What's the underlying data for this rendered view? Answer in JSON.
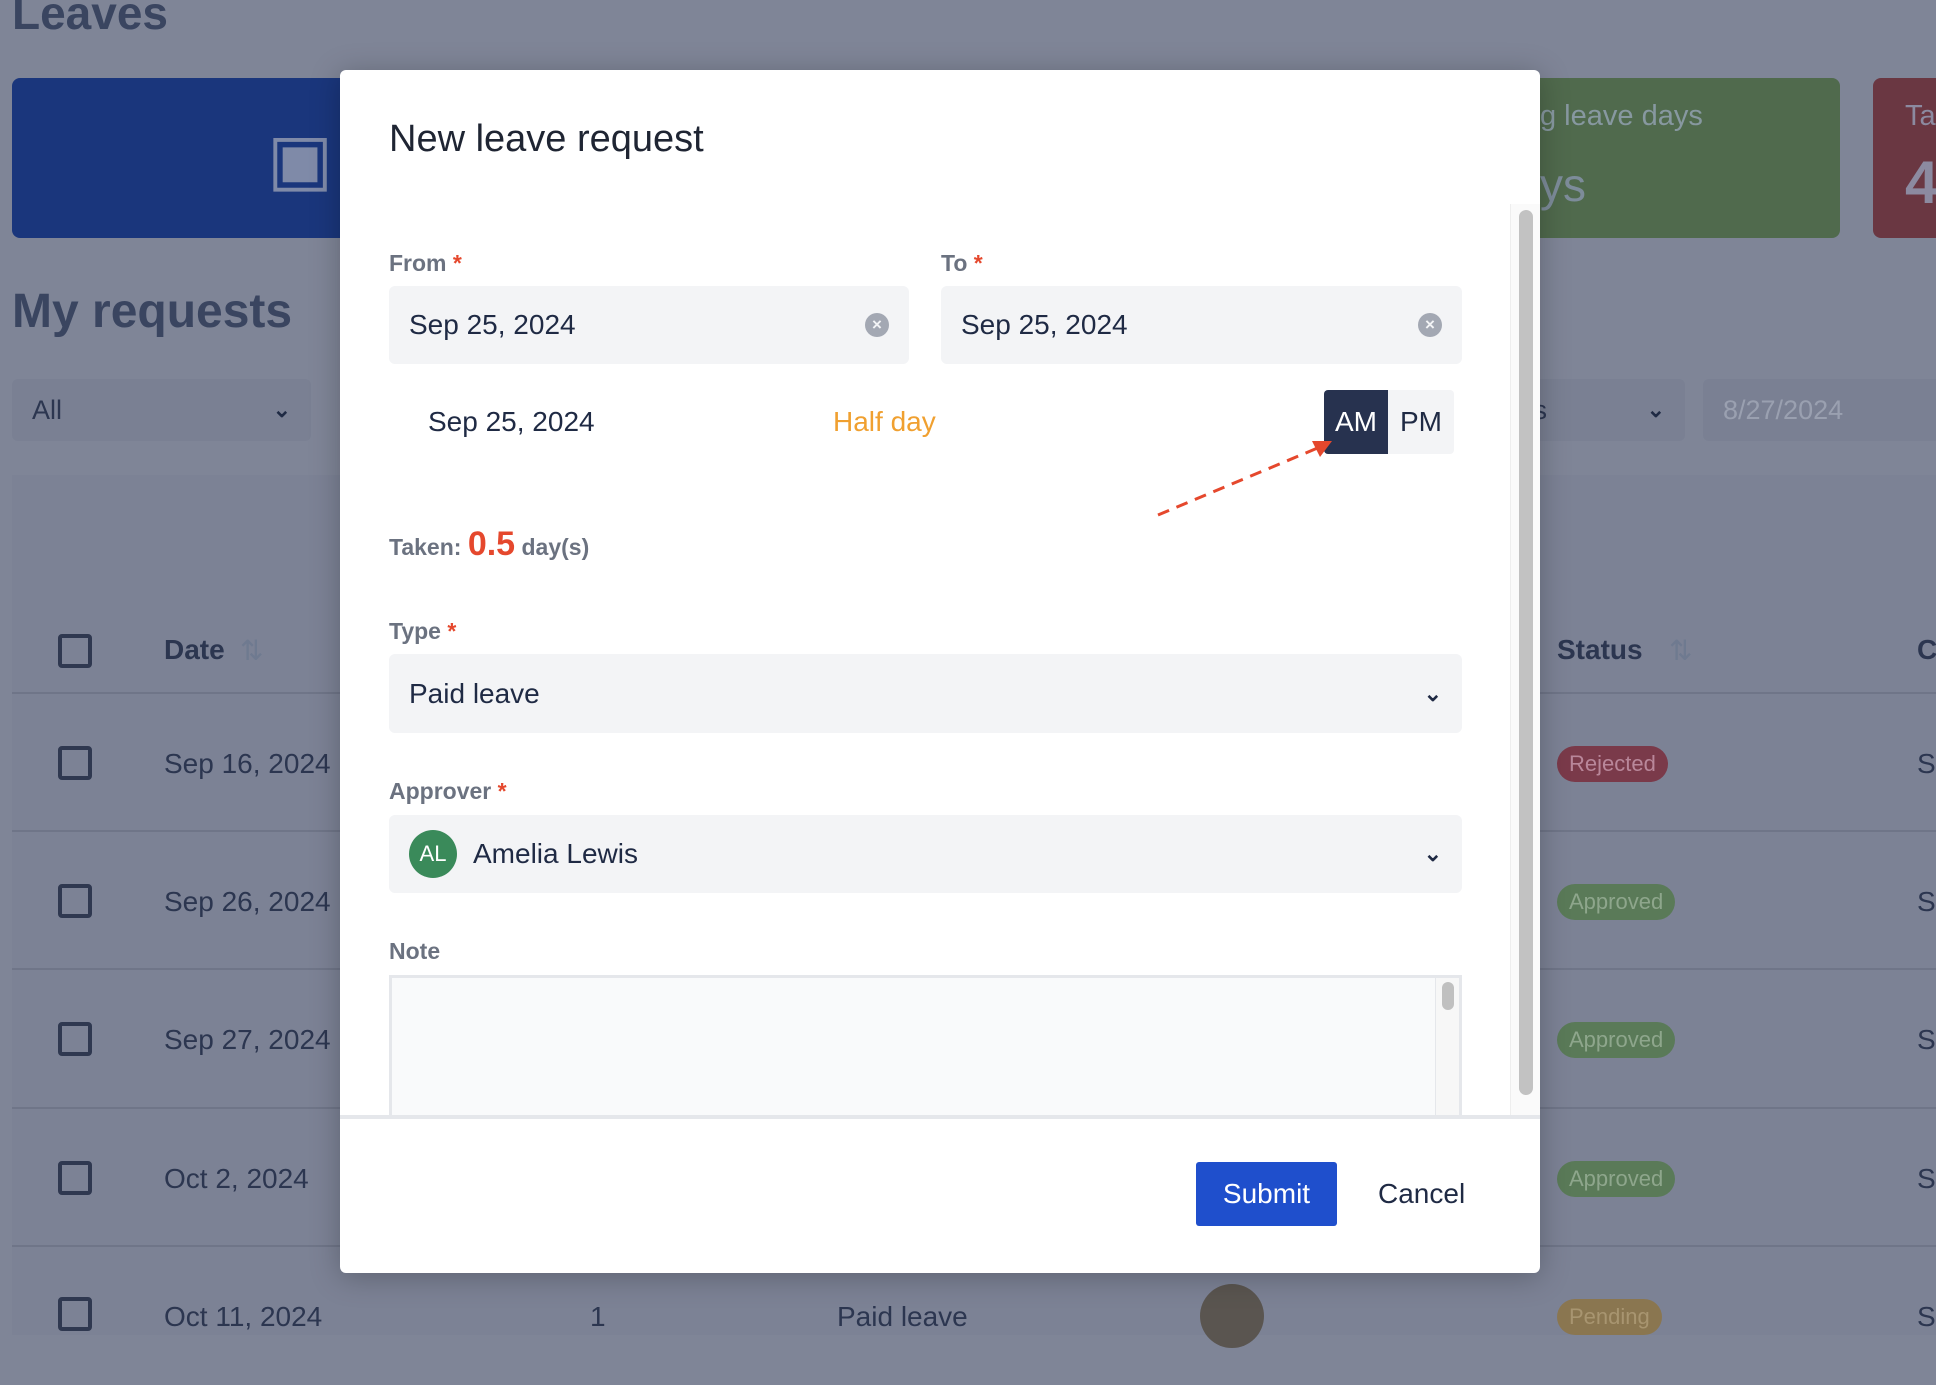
{
  "page": {
    "title": "Leaves",
    "section_title": "My requests",
    "cards": [
      {
        "label": "",
        "icon": "calendar-plus-icon"
      },
      {
        "label": "g leave days",
        "value": "ys"
      },
      {
        "label": "Ta",
        "value": "4"
      }
    ],
    "filters": {
      "status": "All",
      "period": "ys",
      "date": "8/27/2024"
    },
    "table": {
      "headers": [
        "Date",
        "Status",
        "C"
      ],
      "rows": [
        {
          "date": "Sep 16, 2024",
          "status": "Rejected",
          "c": "S"
        },
        {
          "date": "Sep 26, 2024",
          "status": "Approved",
          "c": "S"
        },
        {
          "date": "Sep 27, 2024",
          "status": "Approved",
          "c": "S"
        },
        {
          "date": "Oct 2, 2024",
          "status": "Approved",
          "c": "S"
        },
        {
          "date": "Oct 11, 2024",
          "days": "1",
          "type": "Paid leave",
          "status": "Pending",
          "c": "S"
        }
      ]
    }
  },
  "modal": {
    "title": "New leave request",
    "from_label": "From",
    "to_label": "To",
    "required_mark": "*",
    "from_value": "Sep 25, 2024",
    "to_value": "Sep 25, 2024",
    "day_row": {
      "date": "Sep 25, 2024",
      "half_day": "Half day",
      "am": "AM",
      "pm": "PM",
      "selected": "AM"
    },
    "taken_label": "Taken:",
    "taken_value": "0.5",
    "taken_unit": "day(s)",
    "type_label": "Type",
    "type_value": "Paid leave",
    "approver_label": "Approver",
    "approver_initials": "AL",
    "approver_name": "Amelia Lewis",
    "note_label": "Note",
    "note_value": "",
    "submit": "Submit",
    "cancel": "Cancel"
  },
  "colors": {
    "primary": "#1f4fcc",
    "am_selected": "#27324f",
    "half_day": "#f0a030",
    "taken": "#e5482d",
    "avatar": "#3a8a5a",
    "arrow": "#e5482d"
  }
}
